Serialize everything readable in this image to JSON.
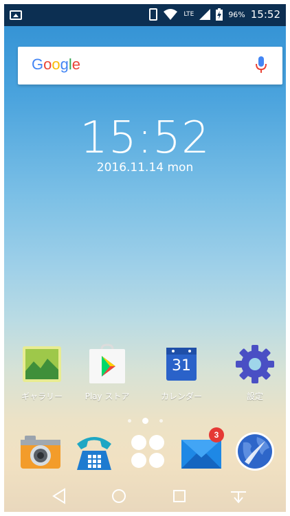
{
  "status_bar": {
    "network": "LTE",
    "battery": "96%",
    "time": "15:52"
  },
  "search": {
    "logo_letters": [
      "G",
      "o",
      "o",
      "g",
      "l",
      "e"
    ],
    "logo_colors": [
      "#4285F4",
      "#EA4335",
      "#FBBC05",
      "#4285F4",
      "#34A853",
      "#EA4335"
    ]
  },
  "clock": {
    "time": "15:52",
    "date": "2016.11.14 mon"
  },
  "apps": [
    {
      "label": "ギャラリー",
      "icon": "gallery-icon"
    },
    {
      "label": "Play ストア",
      "icon": "play-store-icon"
    },
    {
      "label": "カレンダー",
      "icon": "calendar-icon",
      "day": "31"
    },
    {
      "label": "設定",
      "icon": "settings-icon"
    }
  ],
  "page_indicator": {
    "count": 3,
    "active": 1
  },
  "dock": [
    {
      "icon": "camera-icon"
    },
    {
      "icon": "phone-icon"
    },
    {
      "icon": "app-drawer-icon"
    },
    {
      "icon": "mail-icon",
      "badge": "3"
    },
    {
      "icon": "browser-icon"
    }
  ],
  "navigation": [
    "back-icon",
    "home-icon",
    "recents-icon",
    "notification-pull-icon"
  ]
}
